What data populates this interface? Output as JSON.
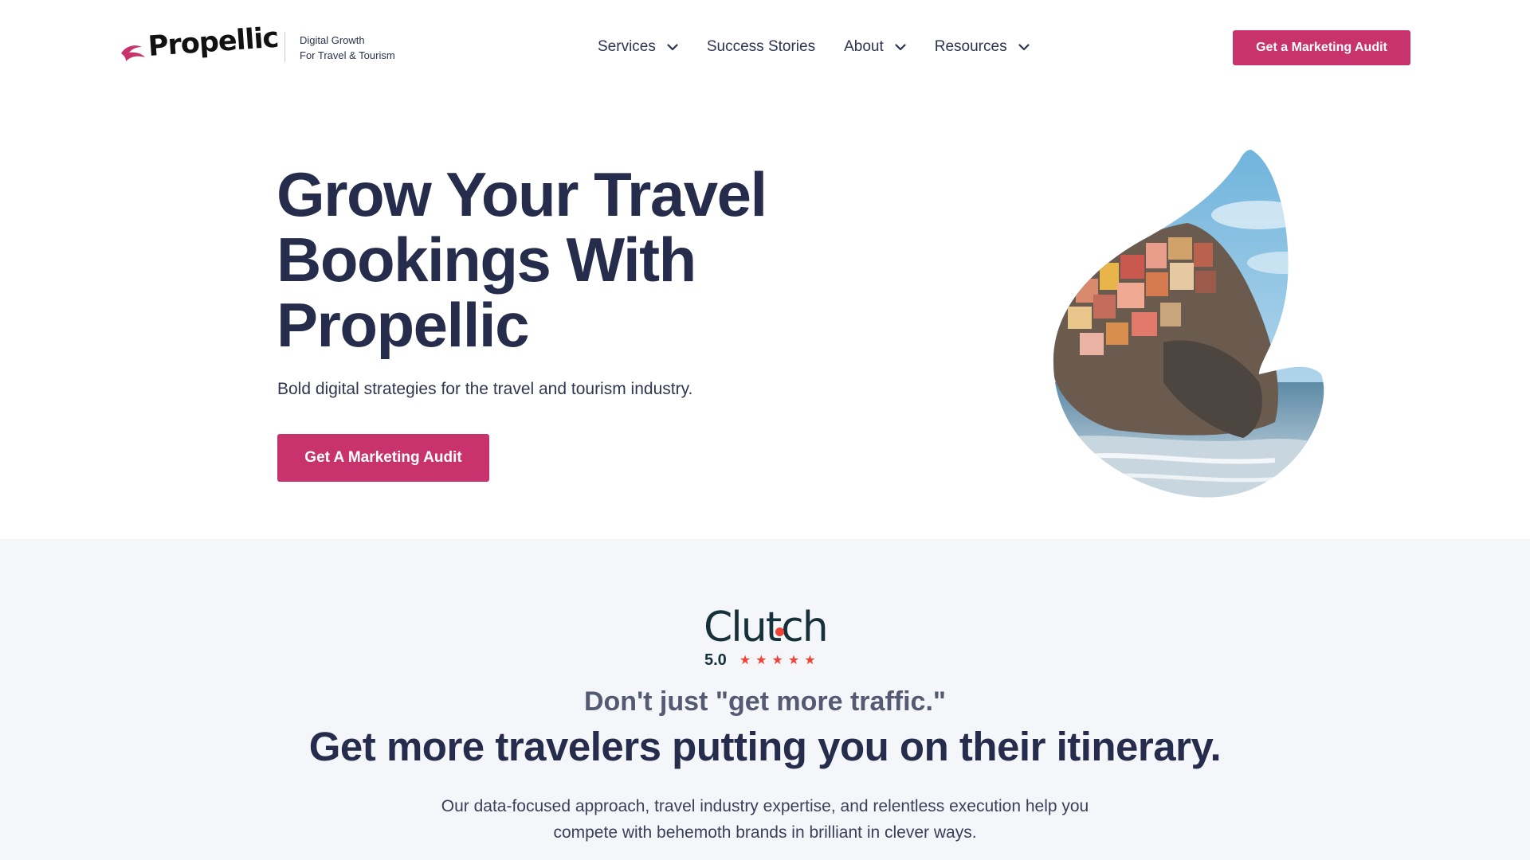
{
  "brand": {
    "name": "Propellic",
    "tagline_line1": "Digital Growth",
    "tagline_line2": "For Travel & Tourism",
    "accent_color": "#c8336d",
    "text_color": "#262c4b"
  },
  "nav": {
    "items": [
      {
        "label": "Services",
        "has_dropdown": true
      },
      {
        "label": "Success Stories",
        "has_dropdown": false
      },
      {
        "label": "About",
        "has_dropdown": true
      },
      {
        "label": "Resources",
        "has_dropdown": true
      }
    ],
    "cta_label": "Get a Marketing Audit"
  },
  "hero": {
    "title_line1": "Grow Your Travel",
    "title_line2": "Bookings With",
    "title_line3": "Propellic",
    "subtitle": "Bold digital strategies for the travel and tourism industry.",
    "cta_label": "Get A Marketing Audit",
    "image_icon": "cliffside-village-leaf-image"
  },
  "trust": {
    "clutch_logo": "Clutch",
    "rating": "5.0",
    "stars": 5,
    "star_color": "#ef4335",
    "kicker": "Don't just \"get more traffic.\"",
    "title": "Get more travelers putting you on their itinerary.",
    "body_line1": "Our data-focused approach, travel industry expertise, and relentless execution help you",
    "body_line2": "compete with behemoth brands in brilliant in clever ways."
  }
}
